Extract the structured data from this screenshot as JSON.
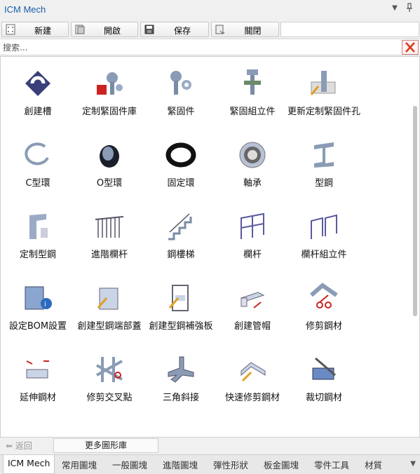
{
  "window": {
    "title": "ICM Mech",
    "pin_glyph": "⬺",
    "menu_glyph": "▼"
  },
  "toolbar": {
    "new_label": "新建",
    "open_label": "開啟",
    "save_label": "保存",
    "close_label": "關閉"
  },
  "search": {
    "placeholder": "搜索...",
    "value": ""
  },
  "items": [
    {
      "label": "創建槽",
      "icon": "slot-icon"
    },
    {
      "label": "定制緊固件庫",
      "icon": "custom-fastener-library-icon"
    },
    {
      "label": "緊固件",
      "icon": "fastener-icon"
    },
    {
      "label": "緊固組立件",
      "icon": "fastener-assembly-icon"
    },
    {
      "label": "更新定制緊固件孔",
      "icon": "update-fastener-hole-icon"
    },
    {
      "label": "C型環",
      "icon": "c-ring-icon"
    },
    {
      "label": "O型環",
      "icon": "o-ring-icon"
    },
    {
      "label": "固定環",
      "icon": "retaining-ring-icon"
    },
    {
      "label": "軸承",
      "icon": "bearing-icon"
    },
    {
      "label": "型鋼",
      "icon": "steel-section-icon"
    },
    {
      "label": "定制型鋼",
      "icon": "custom-steel-section-icon"
    },
    {
      "label": "進階欄杆",
      "icon": "advanced-railing-icon"
    },
    {
      "label": "鋼樓梯",
      "icon": "steel-stair-icon"
    },
    {
      "label": "欄杆",
      "icon": "railing-icon"
    },
    {
      "label": "欄杆組立件",
      "icon": "railing-assembly-icon"
    },
    {
      "label": "設定BOM設置",
      "icon": "bom-settings-icon"
    },
    {
      "label": "創建型鋼端部蓋",
      "icon": "steel-end-cap-icon"
    },
    {
      "label": "創建型鋼補強板",
      "icon": "steel-stiffener-icon"
    },
    {
      "label": "創建管帽",
      "icon": "tube-cap-icon"
    },
    {
      "label": "修剪鋼材",
      "icon": "trim-steel-icon"
    },
    {
      "label": "延伸鋼材",
      "icon": "extend-steel-icon"
    },
    {
      "label": "修剪交叉點",
      "icon": "trim-intersection-icon"
    },
    {
      "label": "三角斜接",
      "icon": "triangle-miter-icon"
    },
    {
      "label": "快速修剪鋼材",
      "icon": "quick-trim-steel-icon"
    },
    {
      "label": "裁切鋼材",
      "icon": "cut-steel-icon"
    },
    {
      "label": "",
      "icon": "partial-icon-1"
    },
    {
      "label": "",
      "icon": "partial-icon-2"
    },
    {
      "label": "",
      "icon": "partial-icon-3"
    },
    {
      "label": "",
      "icon": "partial-icon-4"
    },
    {
      "label": "",
      "icon": "partial-icon-5"
    }
  ],
  "nav": {
    "back_label": "返回",
    "more_label": "更多圖形庫"
  },
  "tabs": [
    "ICM Mech",
    "常用圖塊",
    "一般圖塊",
    "進階圖塊",
    "彈性形狀",
    "板金圖塊",
    "零件工具",
    "材質"
  ],
  "colors": {
    "title": "#1a5fa8",
    "accent_red": "#cc2222",
    "steel": "#8a9bb5"
  }
}
